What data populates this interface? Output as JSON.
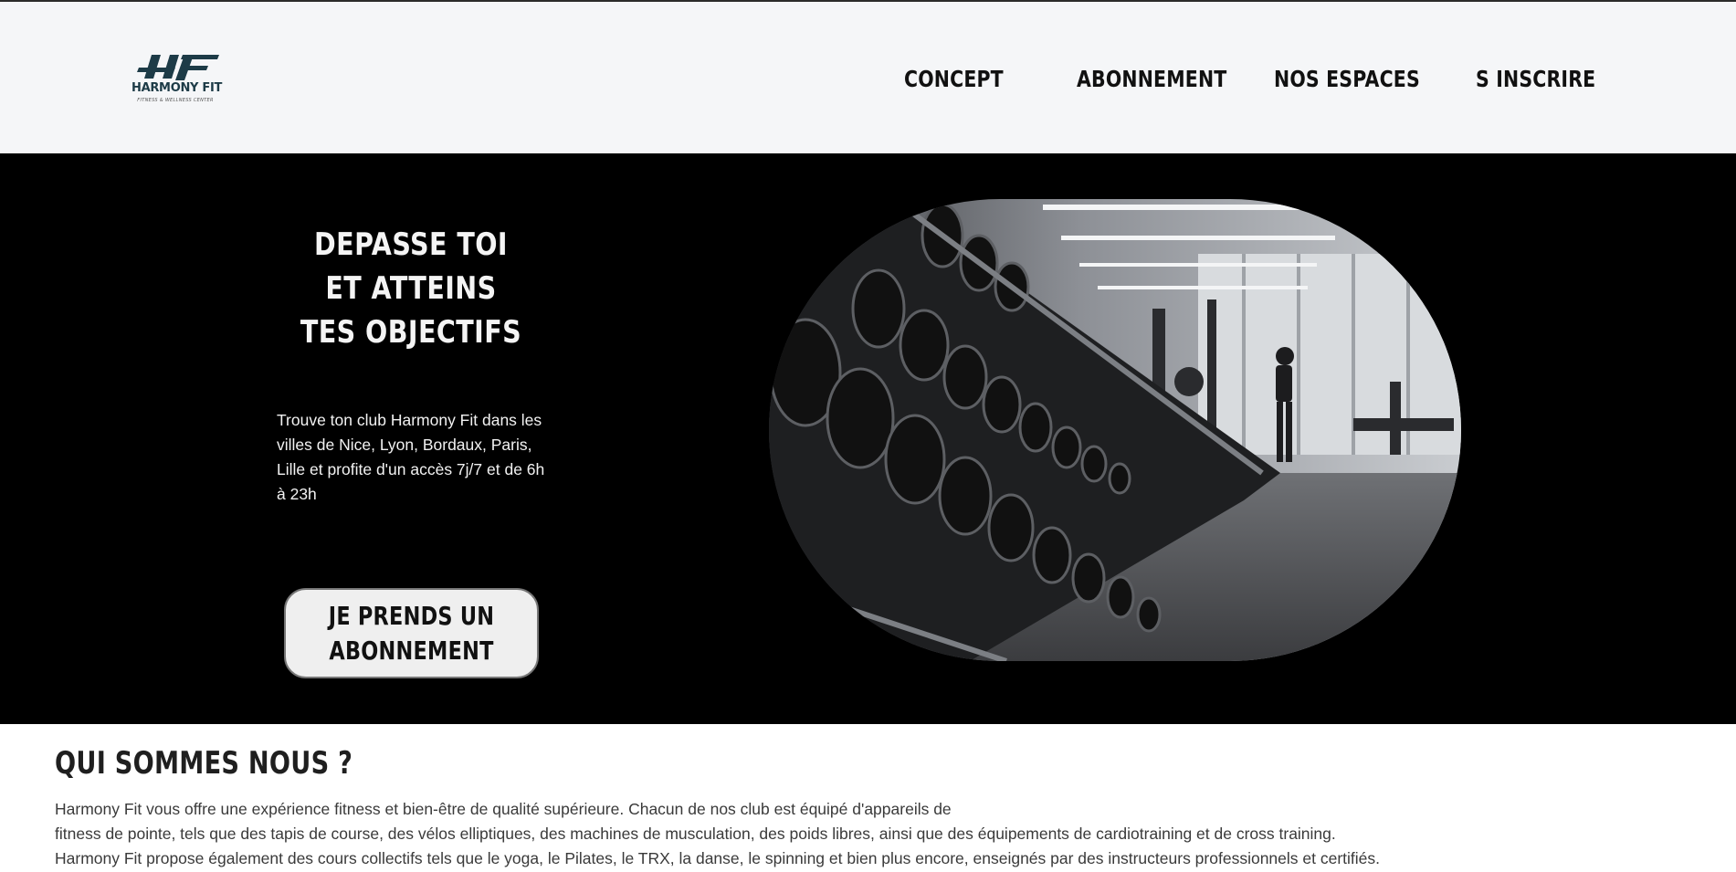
{
  "brand": {
    "name": "HARMONY FIT",
    "tagline": "FITNESS & WELLNESS CENTER",
    "accent": "#1d3b47"
  },
  "nav": {
    "items": [
      {
        "label": "CONCEPT"
      },
      {
        "label": "ABONNEMENT"
      },
      {
        "label": "NOS ESPACES"
      },
      {
        "label": "S INSCRIRE"
      }
    ]
  },
  "hero": {
    "title": "DEPASSE TOI ET ATTEINS TES OBJECTIFS",
    "text": "Trouve ton club Harmony Fit dans les villes de Nice, Lyon, Bordaux, Paris, Lille et profite d'un accès 7j/7 et de 6h à 23h",
    "button_label": "JE PRENDS UN ABONNEMENT",
    "background": "#000000"
  },
  "about": {
    "title": "QUI SOMMES NOUS ?",
    "lines": [
      "Harmony Fit vous offre une expérience fitness et bien-être de qualité supérieure. Chacun de nos club est équipé d'appareils de",
      "fitness de pointe, tels que des tapis de course, des vélos elliptiques, des machines de musculation, des poids libres, ainsi que des équipements de cardiotraining et de cross training.",
      "Harmony Fit propose également des cours collectifs tels que le yoga, le Pilates, le TRX, la danse, le spinning et bien plus encore, enseignés par des instructeurs professionnels et certifiés."
    ]
  }
}
